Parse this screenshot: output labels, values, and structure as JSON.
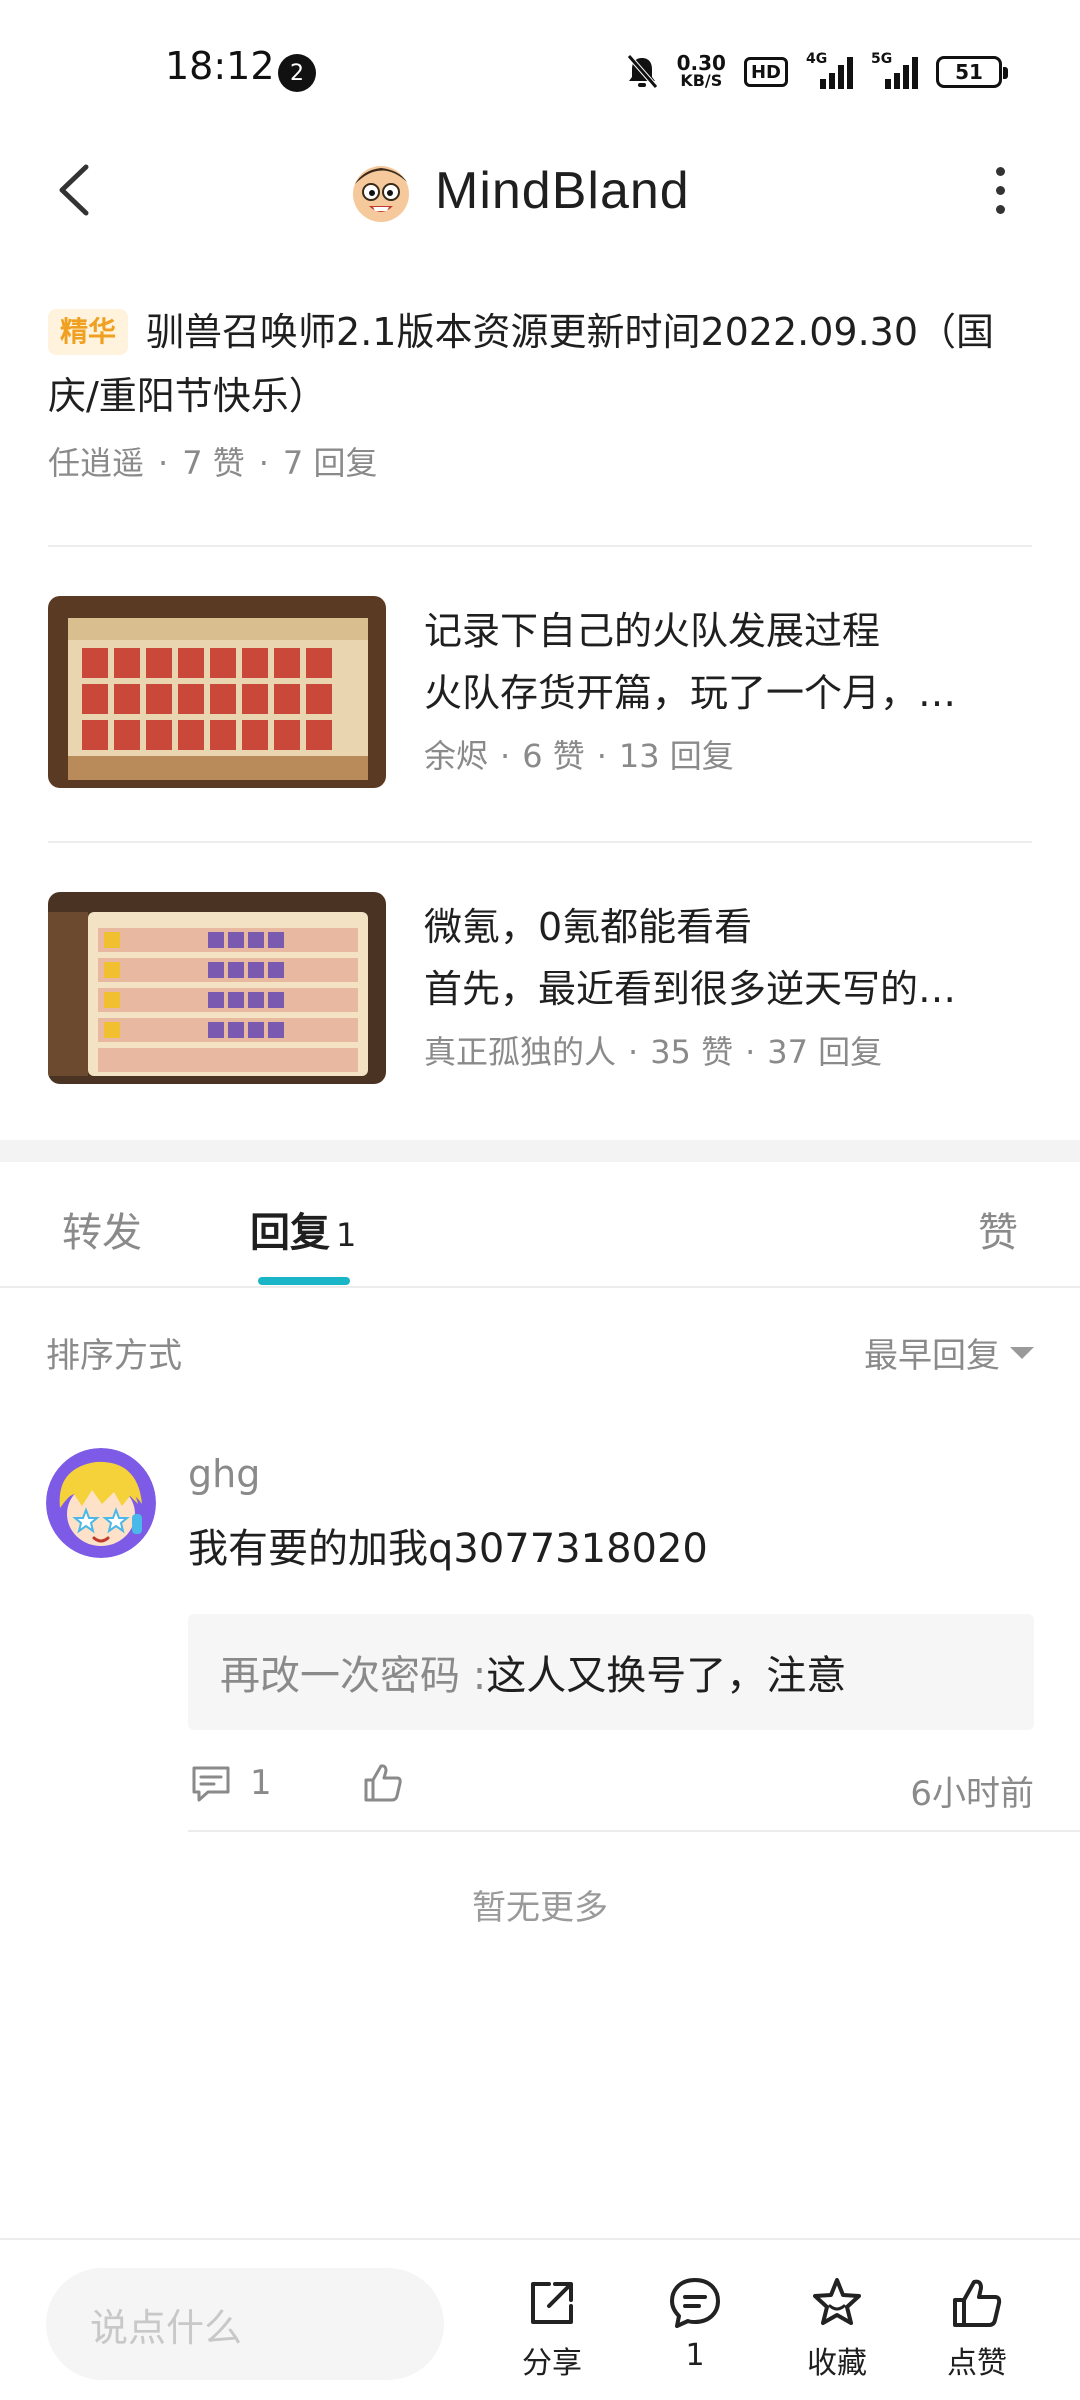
{
  "status_bar": {
    "time": "18:12",
    "notification_count": "2",
    "net_speed": "0.30",
    "net_speed_unit": "KB/S",
    "hd_label": "HD",
    "sim1_tag": "4G",
    "sim2_tag": "5G",
    "battery": "51"
  },
  "header": {
    "title": "MindBland",
    "back_icon": "back-arrow-icon",
    "more_icon": "more-vertical-icon"
  },
  "featured_post": {
    "badge": "精华",
    "title": "驯兽召唤师2.1版本资源更新时间2022.09.30（国庆/重阳节快乐）",
    "author": "任逍遥",
    "likes": "7 赞",
    "replies": "7 回复"
  },
  "related_posts": [
    {
      "title": "记录下自己的火队发展过程",
      "excerpt": "火队存货开篇，玩了一个月，…",
      "author": "余烬",
      "likes": "6 赞",
      "replies": "13 回复"
    },
    {
      "title": "微氪，0氪都能看看",
      "excerpt": "首先，最近看到很多逆天写的…",
      "author": "真正孤独的人",
      "likes": "35 赞",
      "replies": "37 回复"
    }
  ],
  "tabs": {
    "repost": "转发",
    "reply": "回复",
    "reply_count": "1",
    "like": "赞"
  },
  "sort": {
    "label": "排序方式",
    "selected": "最早回复"
  },
  "comment": {
    "username": "ghg",
    "text": "我有要的加我q3077318020",
    "reply_user": "再改一次密码 : ",
    "reply_text": "这人又换号了，注意",
    "reply_count": "1",
    "time": "6小时前"
  },
  "footer_note": "暂无更多",
  "bottom_bar": {
    "input_placeholder": "说点什么",
    "share": "分享",
    "comments": "1",
    "favorite": "收藏",
    "like": "点赞"
  },
  "colors": {
    "accent": "#1ab6c8",
    "essence_badge": "#f0a020",
    "muted_text": "#8a8a8a"
  }
}
